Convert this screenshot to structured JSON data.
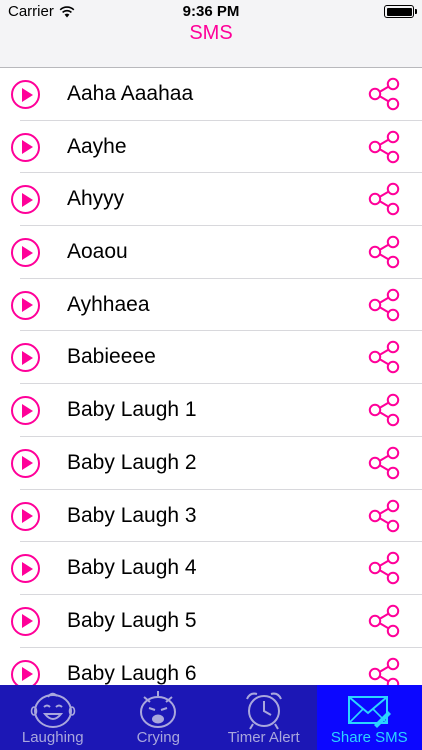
{
  "status_bar": {
    "carrier": "Carrier",
    "time": "9:36 PM"
  },
  "nav": {
    "title": "SMS"
  },
  "colors": {
    "accent": "#ff0099",
    "tab_bar": "#1c17b5",
    "tab_active_bg": "#0c07ff",
    "tab_active_fg": "#2bd5ff",
    "tab_inactive_fg": "#a9a7dd"
  },
  "list": {
    "items": [
      {
        "label": "Aaha Aaahaa"
      },
      {
        "label": "Aayhe"
      },
      {
        "label": "Ahyyy"
      },
      {
        "label": "Aoaou"
      },
      {
        "label": "Ayhhaea"
      },
      {
        "label": "Babieeee"
      },
      {
        "label": "Baby Laugh 1"
      },
      {
        "label": "Baby Laugh 2"
      },
      {
        "label": "Baby Laugh 3"
      },
      {
        "label": "Baby Laugh 4"
      },
      {
        "label": "Baby Laugh 5"
      },
      {
        "label": "Baby Laugh 6"
      }
    ]
  },
  "tabs": [
    {
      "label": "Laughing",
      "icon": "laughing-baby-icon"
    },
    {
      "label": "Crying",
      "icon": "crying-baby-icon"
    },
    {
      "label": "Timer Alert",
      "icon": "alarm-clock-icon"
    },
    {
      "label": "Share SMS",
      "icon": "envelope-icon",
      "active": true
    }
  ]
}
